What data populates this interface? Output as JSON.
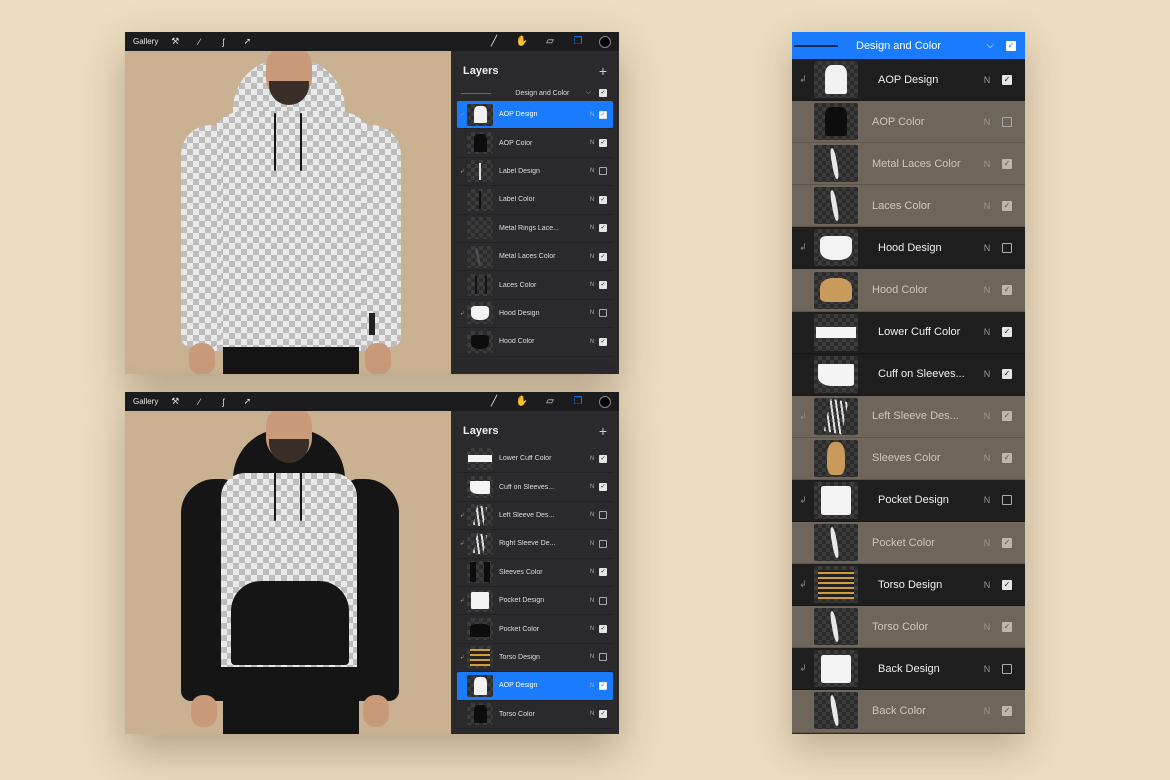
{
  "colors": {
    "accent": "#1a7bff",
    "background": "#ecdcc0",
    "canvas": "#c9b191",
    "panel": "#2a2a2c"
  },
  "screens": [
    {
      "toolbar": {
        "gallery": "Gallery"
      },
      "layers_title": "Layers",
      "group": {
        "label": "Design and Color",
        "checked": true
      },
      "rows": [
        {
          "label": "AOP Design",
          "blend": "N",
          "checked": true,
          "active": true,
          "clip": true,
          "thumb": "white-body"
        },
        {
          "label": "AOP Color",
          "blend": "N",
          "checked": true,
          "active": false,
          "clip": false,
          "thumb": "black-body"
        },
        {
          "label": "Label Design",
          "blend": "N",
          "checked": false,
          "active": false,
          "clip": true,
          "thumb": "label"
        },
        {
          "label": "Label Color",
          "blend": "N",
          "checked": true,
          "active": false,
          "clip": false,
          "thumb": "label-dark"
        },
        {
          "label": "Metal Rings Lace...",
          "blend": "N",
          "checked": true,
          "active": false,
          "clip": false,
          "thumb": "empty"
        },
        {
          "label": "Metal Laces Color",
          "blend": "N",
          "checked": true,
          "active": false,
          "clip": false,
          "thumb": "lace"
        },
        {
          "label": "Laces Color",
          "blend": "N",
          "checked": true,
          "active": false,
          "clip": false,
          "thumb": "lace-dark"
        },
        {
          "label": "Hood Design",
          "blend": "N",
          "checked": false,
          "active": false,
          "clip": true,
          "thumb": "hood-white"
        },
        {
          "label": "Hood Color",
          "blend": "N",
          "checked": true,
          "active": false,
          "clip": false,
          "thumb": "hood-black"
        }
      ]
    },
    {
      "toolbar": {
        "gallery": "Gallery"
      },
      "layers_title": "Layers",
      "rows": [
        {
          "label": "Lower Cuff Color",
          "blend": "N",
          "checked": true,
          "active": false,
          "clip": false,
          "thumb": "cuff"
        },
        {
          "label": "Cuff on Sleeves...",
          "blend": "N",
          "checked": true,
          "active": false,
          "clip": false,
          "thumb": "cuff-small"
        },
        {
          "label": "Left Sleeve Des...",
          "blend": "N",
          "checked": false,
          "active": false,
          "clip": true,
          "thumb": "sleeve-stripes"
        },
        {
          "label": "Right Sleeve De...",
          "blend": "N",
          "checked": false,
          "active": false,
          "clip": true,
          "thumb": "sleeve-stripes"
        },
        {
          "label": "Sleeves Color",
          "blend": "N",
          "checked": true,
          "active": false,
          "clip": false,
          "thumb": "sleeves-black"
        },
        {
          "label": "Pocket Design",
          "blend": "N",
          "checked": false,
          "active": false,
          "clip": true,
          "thumb": "pocket-white"
        },
        {
          "label": "Pocket Color",
          "blend": "N",
          "checked": true,
          "active": false,
          "clip": false,
          "thumb": "pocket-black"
        },
        {
          "label": "Torso Design",
          "blend": "N",
          "checked": false,
          "active": false,
          "clip": true,
          "thumb": "torso-label"
        },
        {
          "label": "AOP Design",
          "blend": "N",
          "checked": true,
          "active": true,
          "clip": false,
          "thumb": "white-body"
        },
        {
          "label": "Torso Color",
          "blend": "N",
          "checked": true,
          "active": false,
          "clip": false,
          "thumb": "black-body"
        }
      ]
    }
  ],
  "panel": {
    "group": {
      "label": "Design and Color",
      "checked": true
    },
    "rows": [
      {
        "label": "AOP Design",
        "blend": "N",
        "checked": true,
        "style": "dark",
        "clip": true,
        "thumb": "white-body"
      },
      {
        "label": "AOP Color",
        "blend": "N",
        "checked": false,
        "style": "tan",
        "clip": false,
        "thumb": "black-body"
      },
      {
        "label": "Metal Laces Color",
        "blend": "N",
        "checked": true,
        "style": "tan",
        "clip": false,
        "thumb": "lace-white"
      },
      {
        "label": "Laces Color",
        "blend": "N",
        "checked": true,
        "style": "tan",
        "clip": false,
        "thumb": "lace-white"
      },
      {
        "label": "Hood Design",
        "blend": "N",
        "checked": false,
        "style": "dark",
        "clip": true,
        "thumb": "hood-white"
      },
      {
        "label": "Hood Color",
        "blend": "N",
        "checked": true,
        "style": "tan",
        "clip": false,
        "thumb": "hood-tan"
      },
      {
        "label": "Lower Cuff Color",
        "blend": "N",
        "checked": true,
        "style": "dark",
        "clip": false,
        "thumb": "cuff"
      },
      {
        "label": "Cuff on Sleeves...",
        "blend": "N",
        "checked": true,
        "style": "dark",
        "clip": false,
        "thumb": "cuff-small"
      },
      {
        "label": "Left Sleeve Des...",
        "blend": "N",
        "checked": true,
        "style": "tan",
        "clip": true,
        "thumb": "sleeve-stripes"
      },
      {
        "label": "Sleeves Color",
        "blend": "N",
        "checked": true,
        "style": "tan",
        "clip": false,
        "thumb": "sleeve-tan"
      },
      {
        "label": "Pocket Design",
        "blend": "N",
        "checked": false,
        "style": "dark",
        "clip": true,
        "thumb": "pocket-white"
      },
      {
        "label": "Pocket Color",
        "blend": "N",
        "checked": true,
        "style": "tan",
        "clip": false,
        "thumb": "lace-white"
      },
      {
        "label": "Torso Design",
        "blend": "N",
        "checked": true,
        "style": "dark",
        "clip": true,
        "thumb": "torso-label"
      },
      {
        "label": "Torso Color",
        "blend": "N",
        "checked": true,
        "style": "tan",
        "clip": false,
        "thumb": "lace-white"
      },
      {
        "label": "Back Design",
        "blend": "N",
        "checked": false,
        "style": "dark",
        "clip": true,
        "thumb": "pocket-white"
      },
      {
        "label": "Back Color",
        "blend": "N",
        "checked": true,
        "style": "tan",
        "clip": false,
        "thumb": "lace-white"
      }
    ]
  }
}
